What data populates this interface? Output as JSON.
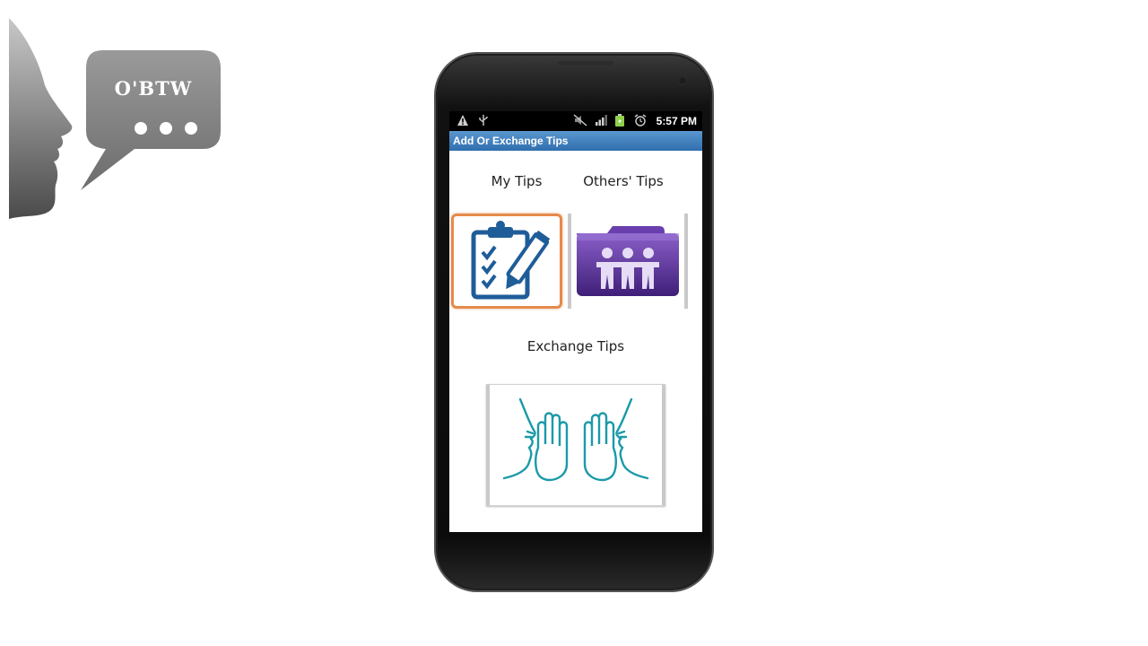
{
  "logo": {
    "text": "O'BTW",
    "icon": "speech-bubble-face-logo"
  },
  "status_bar": {
    "icons": [
      "warning-icon",
      "usb-icon",
      "mute-icon",
      "signal-icon",
      "battery-icon",
      "alarm-icon"
    ],
    "time": "5:57 PM"
  },
  "app": {
    "title": "Add Or Exchange Tips",
    "accent_color": "#2f6eae",
    "selected_color": "#e58a4b"
  },
  "main": {
    "my_tips_label": "My Tips",
    "others_tips_label": "Others' Tips",
    "exchange_tips_label": "Exchange Tips",
    "my_tips_icon": "clipboard-checklist-icon",
    "others_tips_icon": "purple-folder-people-icon",
    "exchange_tips_icon": "high-five-faces-icon"
  }
}
